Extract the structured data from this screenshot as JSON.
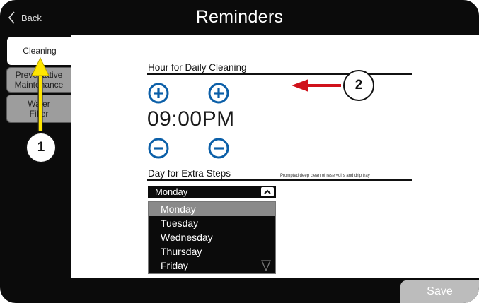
{
  "header": {
    "back_label": "Back",
    "title": "Reminders"
  },
  "tabs": [
    {
      "label": "Cleaning",
      "active": true
    },
    {
      "label": "Preventative Maintenance",
      "active": false
    },
    {
      "label": "Water Filter",
      "active": false
    }
  ],
  "hour_section": {
    "label": "Hour for Daily Cleaning",
    "time": "09:00PM"
  },
  "day_section": {
    "label": "Day for Extra Steps",
    "note": "Prompted deep clean of reservoirs and drip tray",
    "selected": "Monday",
    "options": [
      "Monday",
      "Tuesday",
      "Wednesday",
      "Thursday",
      "Friday"
    ]
  },
  "footer": {
    "save_label": "Save"
  },
  "annotations": {
    "marker_1": "1",
    "marker_2": "2",
    "arrow_color_1": "#ffe600",
    "arrow_color_2": "#d0121b"
  },
  "colors": {
    "accent_blue": "#0b5fa8",
    "frame": "#0b0b0b",
    "tab_inactive": "#9d9d9d",
    "save_disabled": "#bcbcbc"
  }
}
